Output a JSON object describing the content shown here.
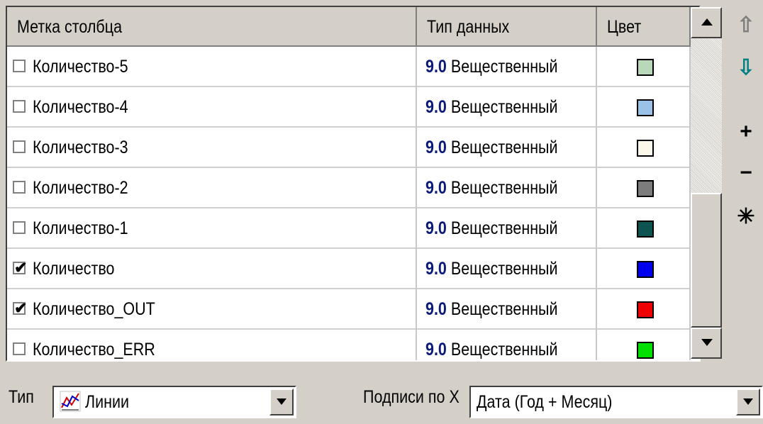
{
  "columns": {
    "label": "Метка столбца",
    "type": "Тип данных",
    "color": "Цвет"
  },
  "rows": [
    {
      "label": "Количество-5",
      "checked": false,
      "type_num": "9.0",
      "type_text": "Вещественный",
      "color": "#b9d7b9"
    },
    {
      "label": "Количество-4",
      "checked": false,
      "type_num": "9.0",
      "type_text": "Вещественный",
      "color": "#9ac1e8"
    },
    {
      "label": "Количество-3",
      "checked": false,
      "type_num": "9.0",
      "type_text": "Вещественный",
      "color": "#fbf8ea"
    },
    {
      "label": "Количество-2",
      "checked": false,
      "type_num": "9.0",
      "type_text": "Вещественный",
      "color": "#7c7c7c"
    },
    {
      "label": "Количество-1",
      "checked": false,
      "type_num": "9.0",
      "type_text": "Вещественный",
      "color": "#0d5450"
    },
    {
      "label": "Количество",
      "checked": true,
      "type_num": "9.0",
      "type_text": "Вещественный",
      "color": "#0000f0"
    },
    {
      "label": "Количество_OUT",
      "checked": true,
      "type_num": "9.0",
      "type_text": "Вещественный",
      "color": "#f00000"
    },
    {
      "label": "Количество_ERR",
      "checked": false,
      "type_num": "9.0",
      "type_text": "Вещественный",
      "color": "#00e000"
    }
  ],
  "side_tools": [
    {
      "name": "move-up-icon",
      "glyph": "⇧",
      "color": "#808080"
    },
    {
      "name": "move-down-icon",
      "glyph": "⇩",
      "color": "#008080"
    },
    {
      "name": "add-icon",
      "glyph": "+",
      "color": "#000000"
    },
    {
      "name": "remove-icon",
      "glyph": "−",
      "color": "#000000"
    },
    {
      "name": "asterisk-icon",
      "glyph": "✳",
      "color": "#000000"
    }
  ],
  "bottom": {
    "type_label": "Тип",
    "type_value": "Линии",
    "xlabels_label": "Подписи по X",
    "xlabels_value": "Дата (Год + Месяц)"
  }
}
